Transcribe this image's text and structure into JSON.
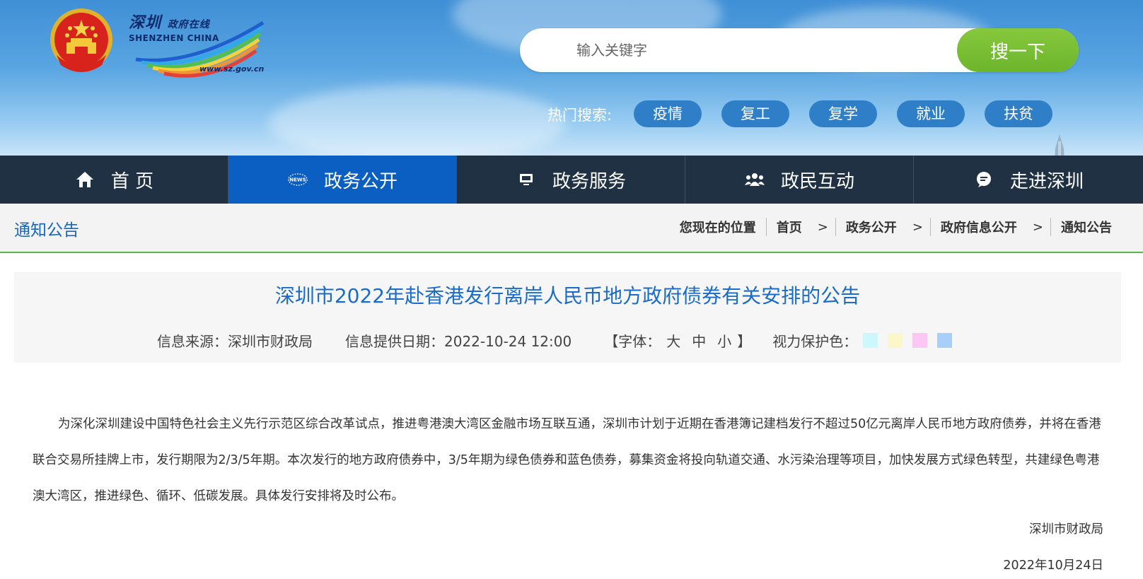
{
  "header": {
    "logo_cn": "深圳",
    "logo_cn_small": "政府在线",
    "logo_en": "SHENZHEN  CHINA",
    "logo_url": "www.sz.gov.cn",
    "search": {
      "placeholder": "输入关键字",
      "button_label": "搜一下"
    },
    "hot_search": {
      "label": "热门搜索:",
      "tags": [
        "疫情",
        "复工",
        "复学",
        "就业",
        "扶贫"
      ]
    }
  },
  "nav": {
    "items": [
      {
        "label": "首 页",
        "icon": "home-icon"
      },
      {
        "label": "政务公开",
        "icon": "news-icon",
        "active": true
      },
      {
        "label": "政务服务",
        "icon": "monitor-icon"
      },
      {
        "label": "政民互动",
        "icon": "people-icon"
      },
      {
        "label": "走进深圳",
        "icon": "chat-bubble-icon"
      }
    ]
  },
  "breadcrumb": {
    "section_title": "通知公告",
    "location_label": "您现在的位置",
    "items": [
      "首页",
      "政务公开",
      "政府信息公开",
      "通知公告"
    ],
    "separator": ">"
  },
  "article": {
    "title": "深圳市2022年赴香港发行离岸人民币地方政府债券有关安排的公告",
    "source": "信息来源：深圳市财政局",
    "date": "信息提供日期：2022-10-24 12:00",
    "font_label_open": "【字体：",
    "font_sizes": [
      "大",
      "中",
      "小"
    ],
    "font_label_close": "】",
    "eye_color_label": "视力保护色：",
    "eye_colors": [
      "#ccf7fb",
      "#fbf7c8",
      "#fbc8f4",
      "#a8cffa"
    ],
    "body": "为深化深圳建设中国特色社会主义先行示范区综合改革试点，推进粤港澳大湾区金融市场互联互通，深圳市计划于近期在香港簿记建档发行不超过50亿元离岸人民币地方政府债券，并将在香港联合交易所挂牌上市，发行期限为2/3/5年期。本次发行的地方政府债券中，3/5年期为绿色债券和蓝色债券，募集资金将投向轨道交通、水污染治理等项目，加快发展方式绿色转型，共建绿色粤港澳大湾区，推进绿色、循环、低碳发展。具体发行安排将及时公布。",
    "signature": "深圳市财政局",
    "sign_date": "2022年10月24日"
  },
  "colors": {
    "nav_bg": "#1f3142",
    "nav_active": "#0b5fc2",
    "search_button": "#7dbf35",
    "title_blue": "#1a6cc8",
    "divider_green": "#5bb64e"
  }
}
